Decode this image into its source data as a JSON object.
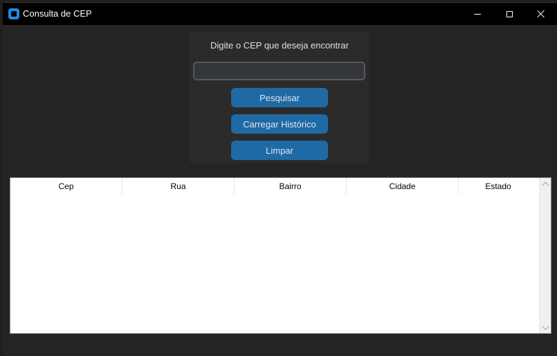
{
  "window": {
    "title": "Consulta de CEP",
    "icon": "app-icon",
    "controls": {
      "minimize": "minimize-icon",
      "maximize": "maximize-icon",
      "close": "close-icon"
    }
  },
  "form": {
    "prompt": "Digite o CEP que deseja encontrar",
    "cep_value": "",
    "cep_placeholder": "",
    "buttons": {
      "search": "Pesquisar",
      "history": "Carregar Histórico",
      "clear": "Limpar"
    }
  },
  "table": {
    "columns": [
      "Cep",
      "Rua",
      "Bairro",
      "Cidade",
      "Estado"
    ],
    "rows": []
  },
  "colors": {
    "window_bg": "#242424",
    "titlebar_bg": "#000000",
    "panel_bg": "#2b2b2b",
    "button_bg": "#1f6aa5",
    "input_bg": "#343638",
    "input_border": "#565b5e"
  }
}
